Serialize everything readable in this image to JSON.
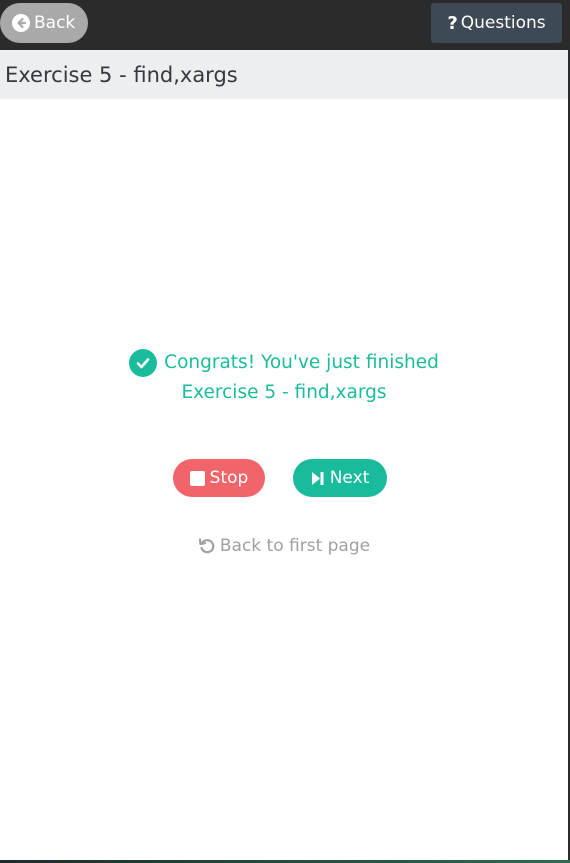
{
  "header": {
    "back_label": "Back",
    "back_icon": "arrow-circle-left-icon",
    "questions_label": "Questions",
    "questions_icon": "question-mark-icon"
  },
  "page": {
    "title": "Exercise 5 - find,xargs"
  },
  "message": {
    "icon": "check-circle-icon",
    "line1": "Congrats! You've just finished",
    "line2": "Exercise 5 - find,xargs",
    "color": "#1abc9c"
  },
  "actions": {
    "stop_label": "Stop",
    "stop_icon": "stop-square-icon",
    "stop_color": "#f0646a",
    "next_label": "Next",
    "next_icon": "step-forward-icon",
    "next_color": "#18bc9c",
    "first_page_label": "Back to first page",
    "first_page_icon": "undo-icon"
  }
}
